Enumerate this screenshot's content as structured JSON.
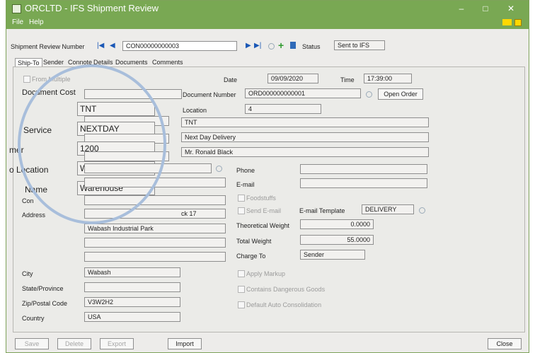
{
  "window": {
    "title": "ORCLTD - IFS Shipment Review",
    "minimize": "–",
    "maximize": "□",
    "close": "✕"
  },
  "menu": [
    "File",
    "Help"
  ],
  "header": {
    "review_label": "Shipment Review Number",
    "review_number": "CON00000000003",
    "status_label": "Status",
    "status_value": "Sent to IFS",
    "nav": {
      "first": "|◀",
      "prev": "◀",
      "next": "▶",
      "last": "▶|",
      "add": "+"
    }
  },
  "tabs": [
    "Ship-To",
    "Sender",
    "Connote",
    "Details",
    "Documents",
    "Comments"
  ],
  "shipto": {
    "from_multiple": "From Multiple",
    "doc_cost_label": "Document Cost",
    "carrier": "TNT",
    "service_label": "Service",
    "service": "NEXTDAY",
    "customer_label": "mer",
    "customer": "1200",
    "location_label": "o Location",
    "location": "WAREHS",
    "name_label": "Name",
    "name": "Warehouse",
    "contact_label": "Con",
    "address_label": "Address",
    "address1": "ck 17",
    "address2": "Wabash Industrial Park",
    "address3": "",
    "address4": "",
    "city_label": "City",
    "city": "Wabash",
    "state_label": "State/Province",
    "state": "",
    "zip_label": "Zip/Postal Code",
    "zip": "V3W2H2",
    "country_label": "Country",
    "country": "USA"
  },
  "right": {
    "date_label": "Date",
    "date": "09/09/2020",
    "time_label": "Time",
    "time": "17:39:00",
    "docnum_label": "Document Number",
    "docnum": "ORD000000000001",
    "open_order": "Open Order",
    "location_label": "Location",
    "location": "4",
    "carrier_desc": "TNT",
    "service_desc": "Next Day Delivery",
    "customer_desc": "Mr. Ronald Black",
    "phone_label": "Phone",
    "email_label": "E-mail",
    "foodstuffs": "Foodstuffs",
    "send_email": "Send E-mail",
    "email_template_label": "E-mail Template",
    "email_template": "DELIVERY",
    "theo_weight_label": "Theoretical Weight",
    "theo_weight": "0.0000",
    "total_weight_label": "Total Weight",
    "total_weight": "55.0000",
    "charge_to_label": "Charge To",
    "charge_to": "Sender",
    "apply_markup": "Apply Markup",
    "dangerous": "Contains Dangerous Goods",
    "auto_consol": "Default Auto Consolidation"
  },
  "buttons": {
    "save": "Save",
    "delete": "Delete",
    "export": "Export",
    "import": "Import",
    "close": "Close"
  },
  "colors": {
    "titlebar": "#79a853",
    "circle": "#a8bedb",
    "panel": "#edecea"
  }
}
